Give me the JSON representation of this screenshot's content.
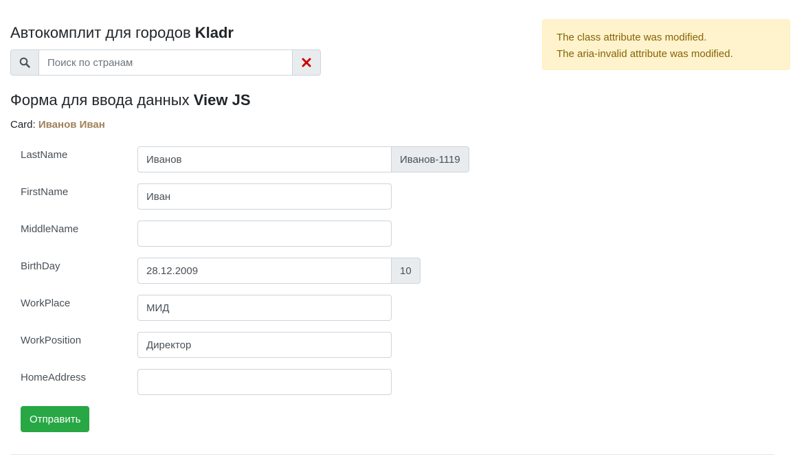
{
  "header": {
    "title_prefix": "Автокомплит для городов",
    "title_bold": "Kladr"
  },
  "search": {
    "placeholder": "Поиск по странам",
    "value": "",
    "search_icon": "search-icon",
    "clear_icon": "close-icon"
  },
  "alert": {
    "lines": [
      "The class attribute was modified.",
      "The aria-invalid attribute was modified."
    ]
  },
  "form": {
    "title_prefix": "Форма для ввода данных",
    "title_bold": "View JS",
    "card_label": "Card:",
    "card_value": "Иванов Иван",
    "fields": [
      {
        "label": "LastName",
        "value": "Иванов",
        "addon": "Иванов-1119"
      },
      {
        "label": "FirstName",
        "value": "Иван"
      },
      {
        "label": "MiddleName",
        "value": ""
      },
      {
        "label": "BirthDay",
        "value": "28.12.2009",
        "addon": "10"
      },
      {
        "label": "WorkPlace",
        "value": "МИД"
      },
      {
        "label": "WorkPosition",
        "value": "Директор"
      },
      {
        "label": "HomeAddress",
        "value": ""
      }
    ],
    "submit_label": "Отправить"
  },
  "colors": {
    "accent_success": "#28a745",
    "alert_bg": "#fff3cd",
    "alert_text": "#856404",
    "card_name": "#a0815a",
    "clear_icon": "#cc0000"
  }
}
